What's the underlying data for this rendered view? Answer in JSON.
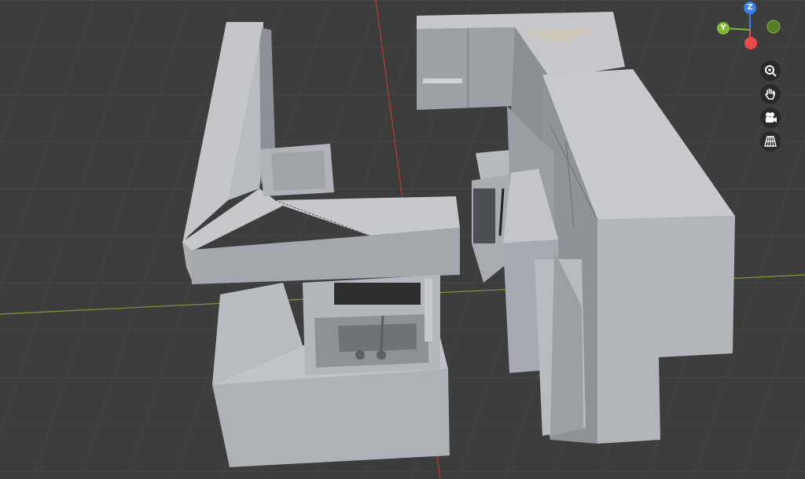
{
  "viewport": {
    "name": "3D viewport",
    "background": "#3d3d3d",
    "grid_color": "#4a4a4a",
    "x_axis_color": "#7a9b3a",
    "y_axis_color": "#b83a3a",
    "model": "kitchen"
  },
  "gizmo": {
    "z_label": "Z",
    "y_label": "Y",
    "x_color": "#e84b4b",
    "y_color": "#7fb83a",
    "z_color": "#3b82e8"
  },
  "nav_buttons": [
    {
      "icon": "zoom-icon"
    },
    {
      "icon": "hand-pan-icon"
    },
    {
      "icon": "camera-icon"
    },
    {
      "icon": "grid-view-icon"
    }
  ]
}
